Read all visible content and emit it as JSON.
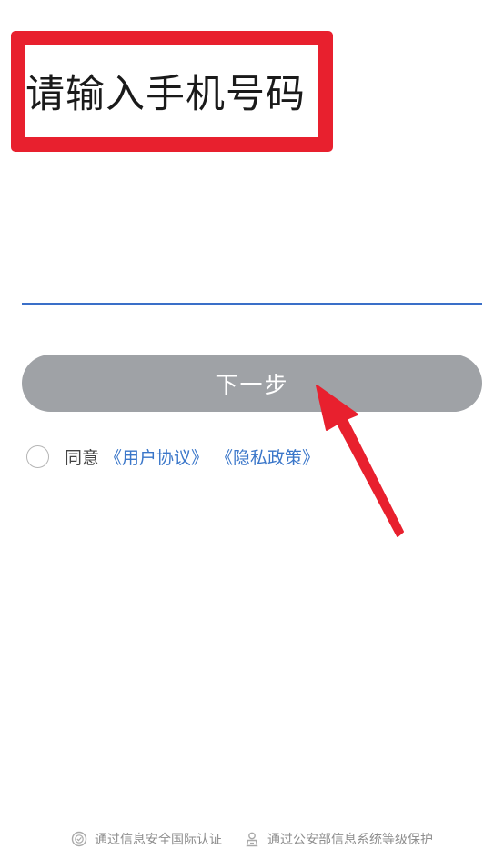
{
  "header": {
    "title": "请输入手机号码"
  },
  "phone": {
    "value": "",
    "placeholder": ""
  },
  "actions": {
    "next_label": "下一步"
  },
  "agreement": {
    "prefix": "同意",
    "user_agreement": "《用户协议》",
    "privacy_policy": "《隐私政策》"
  },
  "footer": {
    "cert_international": "通过信息安全国际认证",
    "cert_police": "通过公安部信息系统等级保护",
    "icons": [
      "security-badge-icon",
      "police-badge-icon"
    ]
  },
  "colors": {
    "annotation_red": "#e8202e",
    "accent_blue": "#3a6fc8",
    "button_gray": "#9fa2a6",
    "link_blue": "#3a76c9"
  }
}
